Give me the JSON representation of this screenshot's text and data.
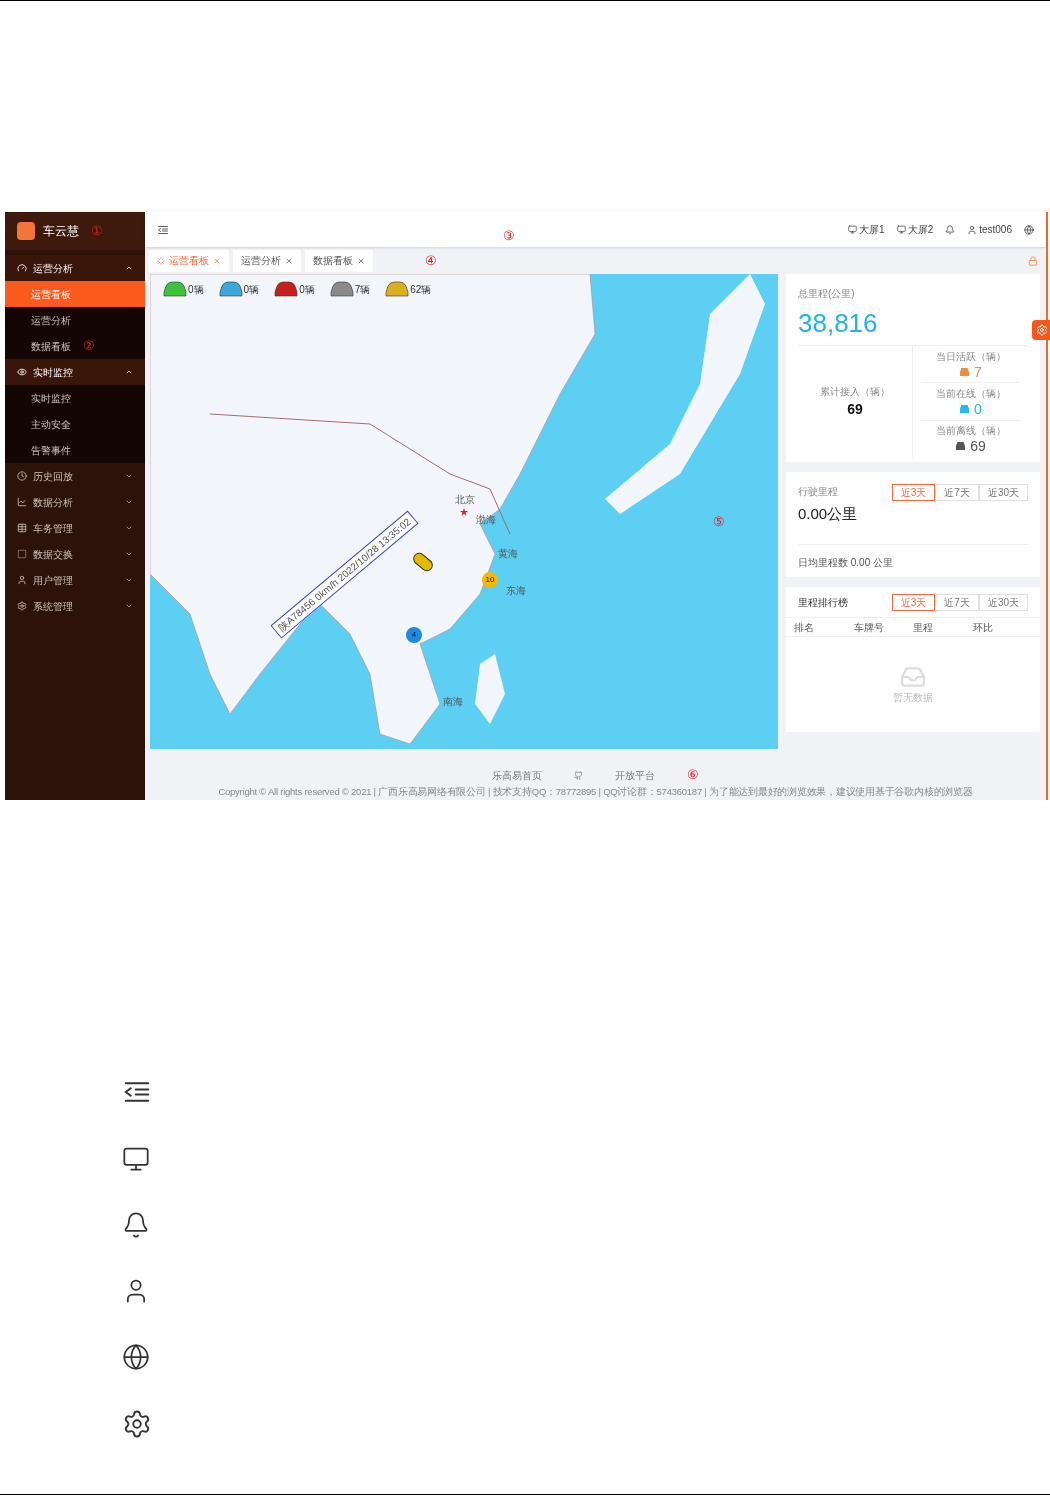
{
  "sidebar": {
    "logo_text": "车云慧",
    "annotation": "①",
    "groups": [
      {
        "label": "运营分析",
        "expanded": true,
        "children": [
          {
            "label": "运营看板",
            "selected": true
          },
          {
            "label": "运营分析",
            "selected": false
          },
          {
            "label": "数据看板",
            "selected": false,
            "annotation": "②"
          }
        ]
      },
      {
        "label": "实时监控",
        "expanded": true,
        "children": [
          {
            "label": "实时监控",
            "selected": false
          },
          {
            "label": "主动安全",
            "selected": false
          },
          {
            "label": "告警事件",
            "selected": false
          }
        ]
      },
      {
        "label": "历史回放",
        "expanded": false
      },
      {
        "label": "数据分析",
        "expanded": false
      },
      {
        "label": "车务管理",
        "expanded": false
      },
      {
        "label": "数据交换",
        "expanded": false
      },
      {
        "label": "用户管理",
        "expanded": false
      },
      {
        "label": "系统管理",
        "expanded": false
      }
    ]
  },
  "header": {
    "annotation": "③",
    "screens": [
      "大屏1",
      "大屏2"
    ],
    "user": "test006"
  },
  "tabs": {
    "annotation": "④",
    "items": [
      {
        "label": "运营看板",
        "selected": true
      },
      {
        "label": "运营分析",
        "selected": false
      },
      {
        "label": "数据看板",
        "selected": false
      }
    ]
  },
  "vehicle_counts": [
    {
      "count": "0辆",
      "color": "#3cc23c"
    },
    {
      "count": "0辆",
      "color": "#3aa8d8"
    },
    {
      "count": "0辆",
      "color": "#c81e1e"
    },
    {
      "count": "7辆",
      "color": "#8a8a8a"
    },
    {
      "count": "62辆",
      "color": "#d8b020"
    }
  ],
  "map": {
    "annotation": "⑤",
    "labels": [
      "北京",
      "渤海",
      "黄海",
      "东海",
      "南海"
    ],
    "tooltip": "陕A78456 0km/h 2022/10/28 13:35:02",
    "clusters": [
      {
        "label": "10",
        "color": "#f5b700"
      },
      {
        "label": "4",
        "color": "#1e88e5"
      }
    ]
  },
  "total_card": {
    "title": "总里程(公里)",
    "value": "38,816",
    "cumulative": {
      "label": "累计接入（辆）",
      "value": "69"
    },
    "statuses": [
      {
        "label": "当日活跃（辆）",
        "value": "7",
        "color": "#f08a3c"
      },
      {
        "label": "当前在线（辆）",
        "value": "0",
        "color": "#29b6e8"
      },
      {
        "label": "当前离线（辆）",
        "value": "69",
        "color": "#555555"
      }
    ]
  },
  "mileage_card": {
    "title": "行驶里程",
    "ranges": [
      {
        "label": "近3天",
        "selected": true
      },
      {
        "label": "近7天",
        "selected": false
      },
      {
        "label": "近30天",
        "selected": false
      }
    ],
    "value": "0.00公里",
    "daily": "日均里程数 0.00 公里"
  },
  "ranking_card": {
    "title": "里程排行榜",
    "ranges": [
      {
        "label": "近3天",
        "selected": true
      },
      {
        "label": "近7天",
        "selected": false
      },
      {
        "label": "近30天",
        "selected": false
      }
    ],
    "columns": [
      "排名",
      "车牌号",
      "里程",
      "环比"
    ],
    "empty": "暂无数据"
  },
  "footer": {
    "links": [
      "乐高易首页",
      "开放平台"
    ],
    "annotation": "⑥",
    "copyright": "Copyright © All rights reserved © 2021 | 广西乐高易网络有限公司 | 技术支持QQ：78772895 | QQ讨论群：574360187 | 为了能达到最好的浏览效果，建议使用基于谷歌内核的浏览器"
  }
}
